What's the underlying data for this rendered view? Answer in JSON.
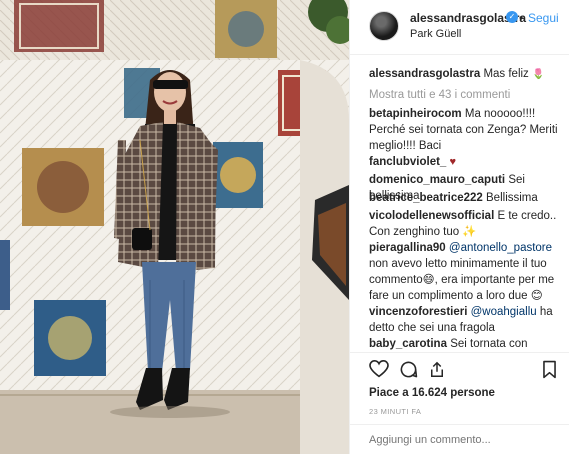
{
  "header": {
    "username": "alessandrasgolastra",
    "verified_icon": "verified-badge-icon",
    "follow_separator": "•",
    "follow_label": "Segui",
    "location": "Park Güell"
  },
  "caption": {
    "username": "alessandrasgolastra",
    "text": "Mas feliz",
    "emoji": "🌷"
  },
  "view_all": "Mostra tutti e 43 i commenti",
  "comments": [
    {
      "user": "betapinheirocom",
      "text": "Ma nooooo!!!! Perché sei tornata con Zenga? Meriti meglio!!!! Baci",
      "mention": ""
    },
    {
      "user": "fanclubviolet_",
      "text": "",
      "emoji": "♥",
      "mention": ""
    },
    {
      "user": "domenico_mauro_caputi",
      "text": "Sei bellissima",
      "mention": ""
    },
    {
      "user": "beatrice_beatrice222",
      "text": "Bellissima",
      "mention": ""
    },
    {
      "user": "vicolodellenewsofficial",
      "text": "E te credo.. Con zenghino tuo",
      "emoji": "✨",
      "mention": ""
    },
    {
      "user": "pieragallina90",
      "mention": "@antonello_pastore",
      "text": "non avevo letto minimamente il tuo commento😄, era importante per me fare un complimento a loro due",
      "emoji": "😊"
    },
    {
      "user": "vincenzoforestieri",
      "mention": "@woahgiallu",
      "text": "ha detto che sei una fragola"
    },
    {
      "user": "baby_carotina",
      "text": "Sei tornata con",
      "mention": ""
    }
  ],
  "actions": {
    "like_icon": "heart-icon",
    "comment_icon": "comment-icon",
    "share_icon": "share-icon",
    "save_icon": "bookmark-icon"
  },
  "likes_text": "Piace a 16.624 persone",
  "timestamp": "23 MINUTI FA",
  "add_comment_placeholder": "Aggiungi un commento..."
}
